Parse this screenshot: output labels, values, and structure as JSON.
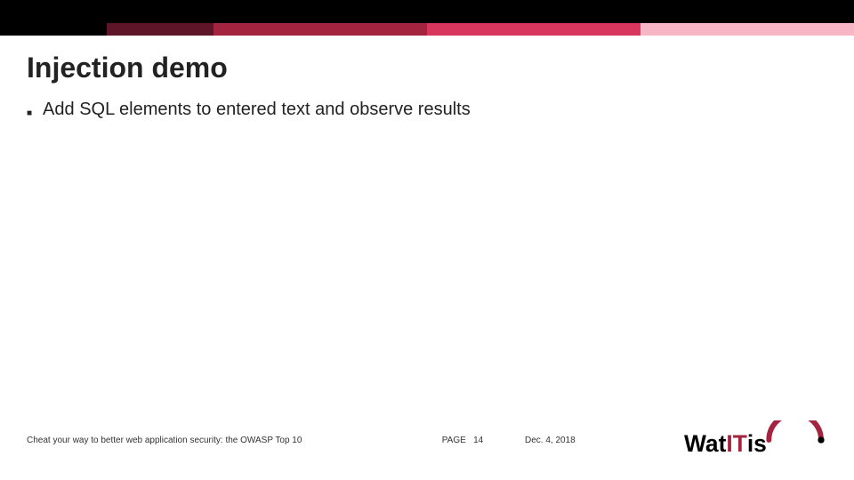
{
  "header": {
    "title": "Injection demo"
  },
  "content": {
    "bullets": [
      "Add SQL elements to entered text and observe results"
    ]
  },
  "footer": {
    "presentation_title": "Cheat your way to better web application security: the OWASP Top 10",
    "page_label": "PAGE",
    "page_number": "14",
    "date": "Dec. 4, 2018",
    "logo_text_1": "Wat",
    "logo_text_2": "IT",
    "logo_text_3": "is"
  },
  "colors": {
    "stripe": [
      "#000000",
      "#5d1628",
      "#a42440",
      "#d9365d",
      "#f6b6c5"
    ],
    "logo_arc": "#a42440",
    "logo_it": "#a42440"
  }
}
